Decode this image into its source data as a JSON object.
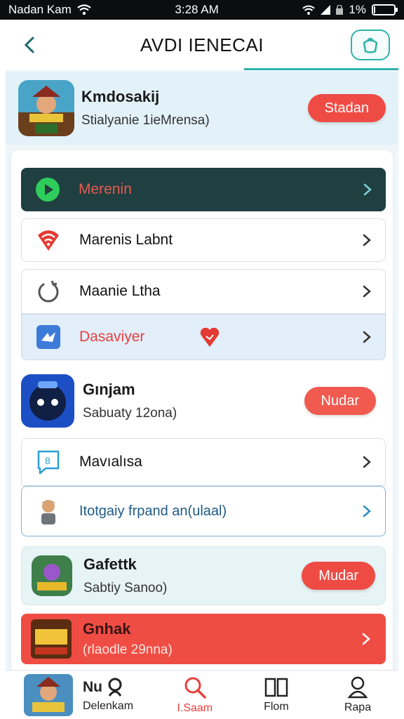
{
  "status_bar": {
    "carrier": "Nadan Kam",
    "time": "3:28 AM",
    "battery": "1%",
    "battery_level": 0.01
  },
  "header": {
    "title": "AVDI IENECAI"
  },
  "top_game": {
    "name": "Kmdosakij",
    "subtitle": "Stialyanie 1ieMrensa)",
    "button": "Stadan"
  },
  "menu": {
    "item1": "Merenin",
    "item2": "Marenis Labnt",
    "item3": "Maanie Ltha",
    "item4": "Dasaviyer"
  },
  "mid_game": {
    "name": "Gınjam",
    "subtitle": "Sabuaty 12ona)",
    "button": "Nudar"
  },
  "menu2": {
    "item1": "Mavıalısa",
    "item2": "Itotgaiy frpand an(ulaal)"
  },
  "game3": {
    "name": "Gafettk",
    "subtitle": "Sabtiy Sanoo)",
    "button": "Mudar"
  },
  "game4": {
    "name": "Gnhak",
    "subtitle": "(rlaodle 29nna)"
  },
  "bottom_nav": {
    "first_title": "Nu",
    "first_sub": "Delenkam",
    "item2": "I.Saam",
    "item3": "Flom",
    "item4": "Rapa"
  },
  "colors": {
    "accent": "#2fb3ad",
    "primary_red": "#ef4b45",
    "dark_row": "#1f3f41"
  }
}
